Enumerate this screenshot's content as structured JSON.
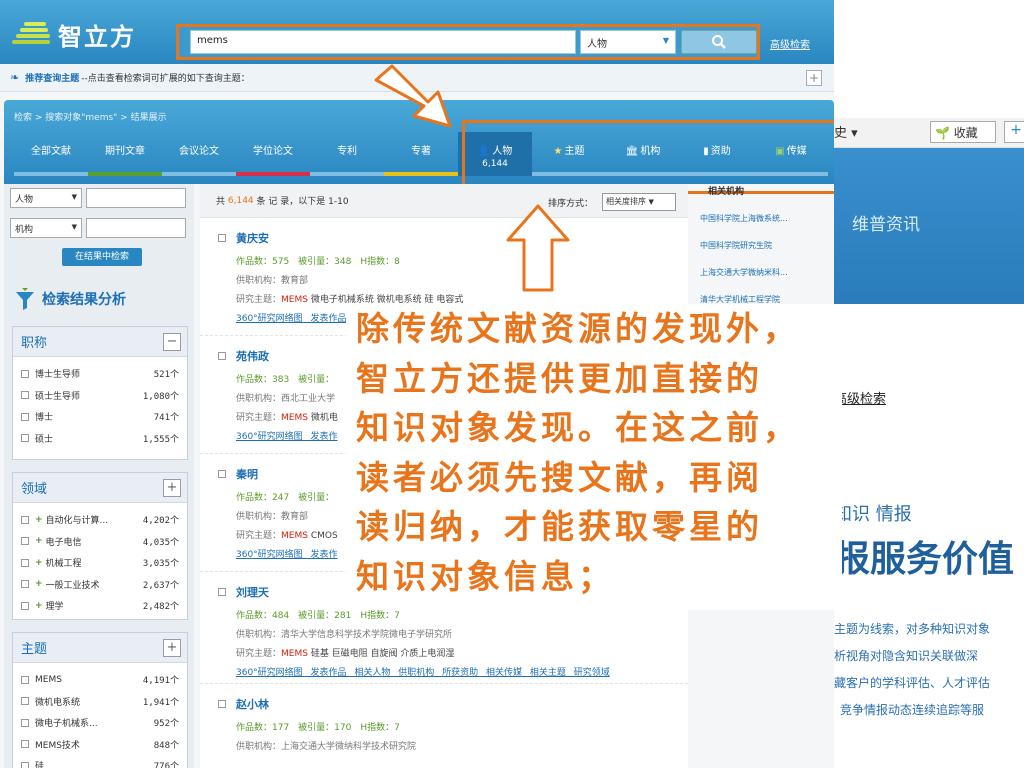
{
  "header": {
    "logo_text": "智立方",
    "search_value": "mems",
    "search_type": "人物",
    "advanced_search": "高级检索"
  },
  "recommend": {
    "label": "推荐查询主题",
    "text": "--点击查看检索词可扩展的如下查询主题："
  },
  "breadcrumb": "检索 > 搜索对象\"mems\" > 结果展示",
  "tabs": [
    {
      "label": "全部文献"
    },
    {
      "label": "期刊文章"
    },
    {
      "label": "会议论文"
    },
    {
      "label": "学位论文"
    },
    {
      "label": "专利"
    },
    {
      "label": "专著"
    },
    {
      "label": "人物",
      "count": "6,144"
    },
    {
      "label": "主题"
    },
    {
      "label": "机构"
    },
    {
      "label": "资助"
    },
    {
      "label": "传媒"
    }
  ],
  "filters": {
    "field1": "人物",
    "field2": "机构",
    "button": "在结果中检索"
  },
  "analysis_title": "检索结果分析",
  "panels": [
    {
      "title": "职称",
      "toggle": "−",
      "items": [
        {
          "label": "博士生导师",
          "count": "521个"
        },
        {
          "label": "硕士生导师",
          "count": "1,080个"
        },
        {
          "label": "博士",
          "count": "741个"
        },
        {
          "label": "硕士",
          "count": "1,555个"
        }
      ]
    },
    {
      "title": "领域",
      "toggle": "+",
      "items": [
        {
          "label": "自动化与计算...",
          "count": "4,202个"
        },
        {
          "label": "电子电信",
          "count": "4,035个"
        },
        {
          "label": "机械工程",
          "count": "3,035个"
        },
        {
          "label": "一般工业技术",
          "count": "2,637个"
        },
        {
          "label": "理学",
          "count": "2,482个"
        }
      ]
    },
    {
      "title": "主题",
      "toggle": "+",
      "items": [
        {
          "label": "MEMS",
          "count": "4,191个"
        },
        {
          "label": "微机电系统",
          "count": "1,941个"
        },
        {
          "label": "微电子机械系...",
          "count": "952个"
        },
        {
          "label": "MEMS技术",
          "count": "848个"
        },
        {
          "label": "硅",
          "count": "776个"
        }
      ]
    }
  ],
  "results_header": {
    "prefix": "共",
    "total": "6,144",
    "suffix": "条 记 录，以下是 1-10",
    "sort_label": "排序方式：",
    "sort_value": "相关度排序"
  },
  "results": [
    {
      "name": "黄庆安",
      "stats": "作品数：575　被引量：348　H指数：8",
      "org": "供职机构：教育部",
      "topics_prefix": "研究主题：",
      "topics_hl": "MEMS",
      "topics": " 微电子机械系统 微机电系统 硅 电容式",
      "links": "360°研究网络图 发表作品"
    },
    {
      "name": "苑伟政",
      "stats": "作品数：383　被引量：",
      "org": "供职机构：西北工业大学",
      "topics_prefix": "研究主题：",
      "topics_hl": "MEMS",
      "topics": " 微机电",
      "links": "360°研究网络图 发表作"
    },
    {
      "name": "秦明",
      "stats": "作品数：247　被引量：",
      "org": "供职机构：教育部",
      "topics_prefix": "研究主题：",
      "topics_hl": "MEMS",
      "topics": " CMOS",
      "links": "360°研究网络图 发表作"
    },
    {
      "name": "刘理天",
      "stats": "作品数：484　被引量：281　H指数：7",
      "org": "供职机构：清华大学信息科学技术学院微电子学研究所",
      "topics_prefix": "研究主题：",
      "topics_hl": "MEMS",
      "topics": " 硅基 巨磁电阻 自旋阀 介质上电润湿",
      "links": "360°研究网络图 发表作品 相关人物 供职机构 所获资助 相关传媒 相关主题 研究领域"
    },
    {
      "name": "赵小林",
      "stats": "作品数：177　被引量：170　H指数：7",
      "org": "供职机构：上海交通大学微纳科学技术研究院",
      "topics_prefix": "",
      "topics_hl": "",
      "topics": "",
      "links": ""
    }
  ],
  "related": {
    "title": "相关机构",
    "items": [
      "中国科学院上海微系统...",
      "中国科学院研究生院",
      "上海交通大学微纳米科...",
      "清华大学机械工程学院"
    ]
  },
  "background": {
    "history": "史 ▾",
    "favorite": "收藏",
    "plus": "+",
    "brand": "维普资讯",
    "adv": "高级检索",
    "line1": "知识 情报",
    "line2": "报服务价值",
    "p1": "主题为线索，对多种知识对象",
    "p2": "析视角对隐含知识关联做深",
    "p3": "藏客户的学科评估、人才评估",
    "p4": "竞争情报动态连续追踪等服"
  },
  "callout": {
    "lines": [
      "除传统文献资源的发现外，",
      "智立方还提供更加直接的",
      "知识对象发现。在这之前，",
      "读者必须先搜文献，再阅",
      "读归纳，才能获取零星的",
      "知识对象信息；"
    ]
  },
  "colors": {
    "accent": "#e8741b",
    "brand_blue": "#2a86c0",
    "highlight": "#d81e06"
  }
}
